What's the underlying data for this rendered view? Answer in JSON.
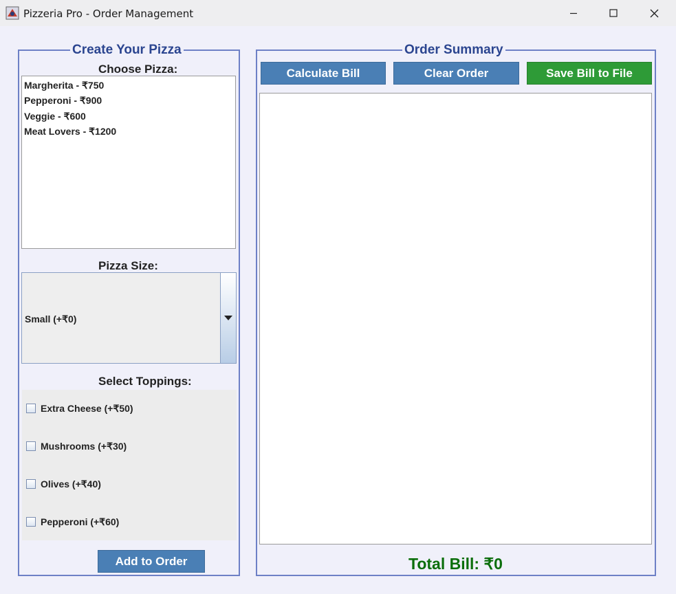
{
  "window": {
    "title": "Pizzeria Pro - Order Management",
    "icons": {
      "app": "app-icon",
      "minimize": "minimize-icon",
      "maximize": "maximize-icon",
      "close": "close-icon"
    }
  },
  "left_panel": {
    "title": "Create Your Pizza",
    "choose_label": "Choose Pizza:",
    "pizzas": [
      "Margherita - ₹750",
      "Pepperoni - ₹900",
      "Veggie - ₹600",
      "Meat Lovers - ₹1200"
    ],
    "size_label": "Pizza Size:",
    "size_selected": "Small (+₹0)",
    "toppings_label": "Select Toppings:",
    "toppings": [
      "Extra Cheese (+₹50)",
      "Mushrooms (+₹30)",
      "Olives (+₹40)",
      "Pepperoni (+₹60)"
    ],
    "add_button": "Add to Order"
  },
  "right_panel": {
    "title": "Order Summary",
    "buttons": {
      "calculate": "Calculate Bill",
      "clear": "Clear Order",
      "save": "Save Bill to File"
    },
    "summary_text": "",
    "total": "Total Bill: ₹0"
  },
  "colors": {
    "panel_border": "#6d80c6",
    "title_blue": "#2b4590",
    "button_blue": "#4a7fb5",
    "button_green": "#2e9b37",
    "total_green": "#0b6e0b"
  }
}
